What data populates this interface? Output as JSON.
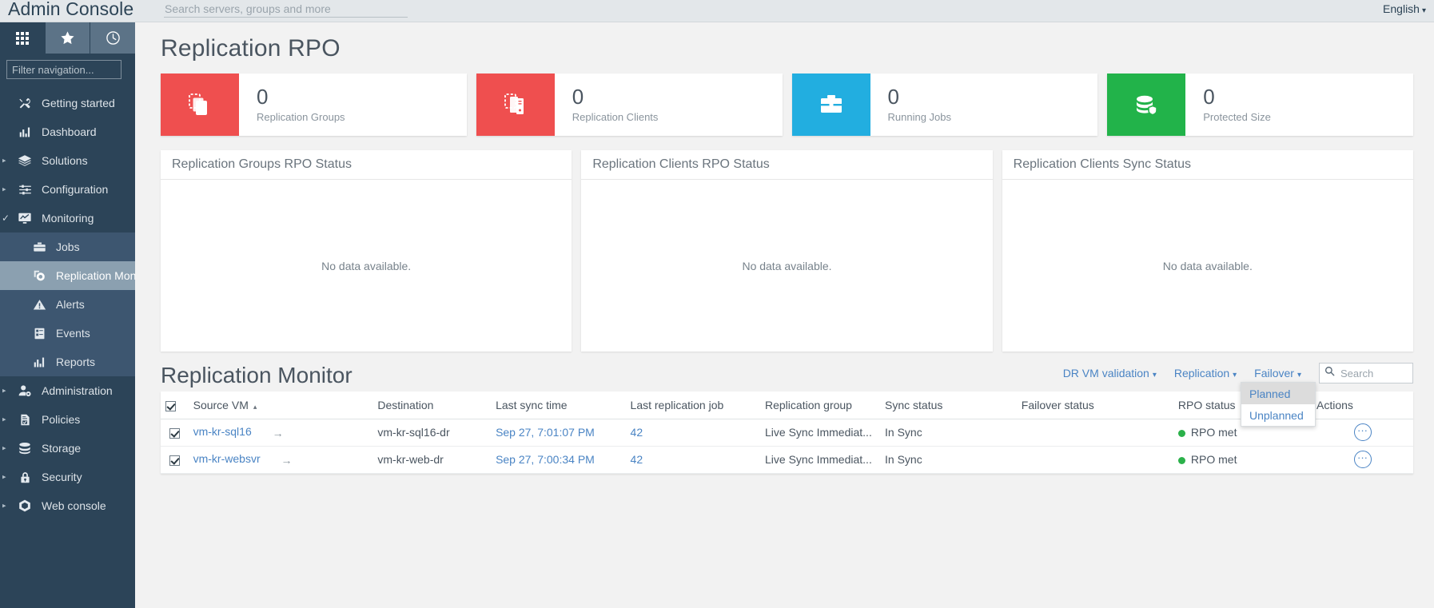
{
  "topbar": {
    "app_title": "Admin Console",
    "search_placeholder": "Search servers, groups and more",
    "search_value": "",
    "language": "English",
    "caret": "▾"
  },
  "sidebar": {
    "tabs": [
      {
        "name": "grid-tab",
        "icon": "grid-icon",
        "active": true
      },
      {
        "name": "favorites-tab",
        "icon": "star-icon",
        "active": false
      },
      {
        "name": "recents-tab",
        "icon": "clock-icon",
        "active": false
      }
    ],
    "filter_placeholder": "Filter navigation...",
    "filter_value": "",
    "items": [
      {
        "label": "Getting started",
        "icon": "tools-icon",
        "arrow": "",
        "state": ""
      },
      {
        "label": "Dashboard",
        "icon": "dashboard-icon",
        "arrow": "",
        "state": ""
      },
      {
        "label": "Solutions",
        "icon": "layers-icon",
        "arrow": "▸",
        "state": ""
      },
      {
        "label": "Configuration",
        "icon": "sliders-icon",
        "arrow": "▸",
        "state": ""
      },
      {
        "label": "Monitoring",
        "icon": "monitor-chart-icon",
        "arrow": "✓",
        "state": "expanded"
      },
      {
        "label": "Jobs",
        "icon": "briefcase-icon",
        "arrow": "",
        "state": "child"
      },
      {
        "label": "Replication Monitor",
        "icon": "replication-icon",
        "arrow": "",
        "state": "child-selected"
      },
      {
        "label": "Alerts",
        "icon": "alert-triangle-icon",
        "arrow": "",
        "state": "child"
      },
      {
        "label": "Events",
        "icon": "events-icon",
        "arrow": "",
        "state": "child"
      },
      {
        "label": "Reports",
        "icon": "reports-icon",
        "arrow": "",
        "state": "child"
      },
      {
        "label": "Administration",
        "icon": "user-gear-icon",
        "arrow": "▸",
        "state": ""
      },
      {
        "label": "Policies",
        "icon": "policy-doc-icon",
        "arrow": "▸",
        "state": ""
      },
      {
        "label": "Storage",
        "icon": "storage-icon",
        "arrow": "▸",
        "state": ""
      },
      {
        "label": "Security",
        "icon": "lock-icon",
        "arrow": "▸",
        "state": ""
      },
      {
        "label": "Web console",
        "icon": "web-console-icon",
        "arrow": "▸",
        "state": ""
      }
    ]
  },
  "page": {
    "title": "Replication RPO",
    "section_title": "Replication Monitor"
  },
  "kpis": [
    {
      "value": "0",
      "label": "Replication Groups",
      "icon": "replication-groups-icon",
      "color": "#ef4f4f"
    },
    {
      "value": "0",
      "label": "Replication Clients",
      "icon": "replication-clients-icon",
      "color": "#ef4f4f"
    },
    {
      "value": "0",
      "label": "Running Jobs",
      "icon": "running-jobs-icon",
      "color": "#22aee0"
    },
    {
      "value": "0",
      "label": "Protected Size",
      "icon": "protected-size-icon",
      "color": "#22b34a"
    }
  ],
  "panels": [
    {
      "title": "Replication Groups RPO Status",
      "empty_text": "No data available."
    },
    {
      "title": "Replication Clients RPO Status",
      "empty_text": "No data available."
    },
    {
      "title": "Replication Clients Sync Status",
      "empty_text": "No data available."
    }
  ],
  "toolbar": {
    "links": [
      {
        "label": "DR VM validation",
        "caret": "▾"
      },
      {
        "label": "Replication",
        "caret": "▾"
      },
      {
        "label": "Failover",
        "caret": "▾"
      }
    ],
    "search_placeholder": "Search",
    "search_value": "",
    "search_icon": "magnifier-icon"
  },
  "dropdown": {
    "open": true,
    "items": [
      {
        "label": "Planned",
        "hovered": true
      },
      {
        "label": "Unplanned",
        "hovered": false
      }
    ]
  },
  "table": {
    "header_checkbox_checked": true,
    "sort_indicator": "▴",
    "arrow_glyph": "→",
    "columns": [
      "Source VM",
      "Destination",
      "Last sync time",
      "Last replication job",
      "Replication group",
      "Sync status",
      "Failover status",
      "RPO status",
      "Actions"
    ],
    "rows": [
      {
        "checked": true,
        "source_vm": "vm-kr-sql16",
        "destination": "vm-kr-sql16-dr",
        "last_sync_time": "Sep 27, 7:01:07 PM",
        "last_replication_job": "42",
        "replication_group": "Live Sync Immediat...",
        "sync_status": "In Sync",
        "failover_status": "",
        "rpo_status": "RPO met",
        "actions": "···"
      },
      {
        "checked": true,
        "source_vm": "vm-kr-websvr",
        "destination": "vm-kr-web-dr",
        "last_sync_time": "Sep 27, 7:00:34 PM",
        "last_replication_job": "42",
        "replication_group": "Live Sync Immediat...",
        "sync_status": "In Sync",
        "failover_status": "",
        "rpo_status": "RPO met",
        "actions": "···"
      }
    ]
  },
  "colors": {
    "sidebar_bg": "#2c4458",
    "sidebar_selected": "#8ba0b0",
    "sidebar_child": "#3d5670",
    "accent_link": "#4a84c4",
    "status_green": "#2bb14a",
    "kpi_red": "#ef4f4f",
    "kpi_blue": "#22aee0",
    "kpi_green": "#22b34a"
  }
}
